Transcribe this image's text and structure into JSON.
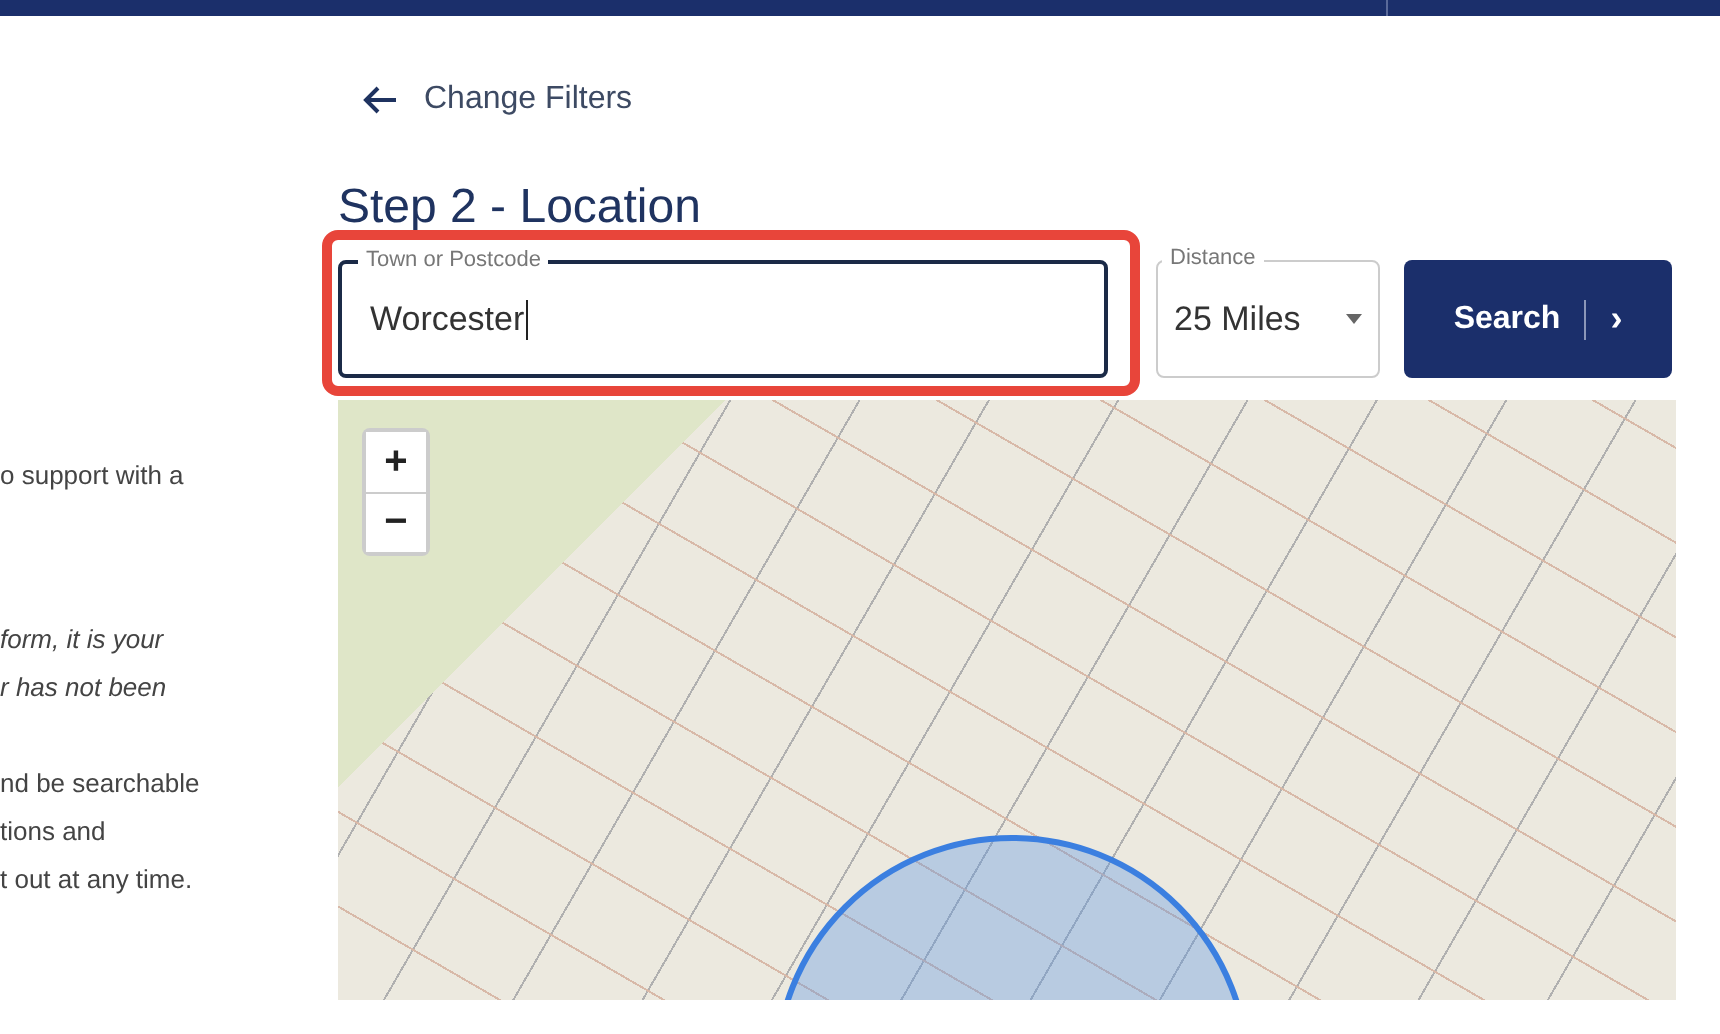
{
  "back_link": {
    "label": "Change Filters"
  },
  "heading": "Step 2 - Location",
  "side_text": [
    {
      "text": "o support with a",
      "italic": false
    },
    {
      "text": "form, it is your",
      "italic": true
    },
    {
      "text": "r has not been",
      "italic": true
    },
    {
      "text": "nd be searchable",
      "italic": false
    },
    {
      "text": "tions and",
      "italic": false
    },
    {
      "text": "t out at any time.",
      "italic": false
    }
  ],
  "location_field": {
    "label": "Town or Postcode",
    "value": "Worcester",
    "highlighted": true
  },
  "distance_field": {
    "label": "Distance",
    "value": "25 Miles"
  },
  "search_button": {
    "label": "Search",
    "icon": "›"
  },
  "map": {
    "zoom_in": "+",
    "zoom_out": "−"
  }
}
